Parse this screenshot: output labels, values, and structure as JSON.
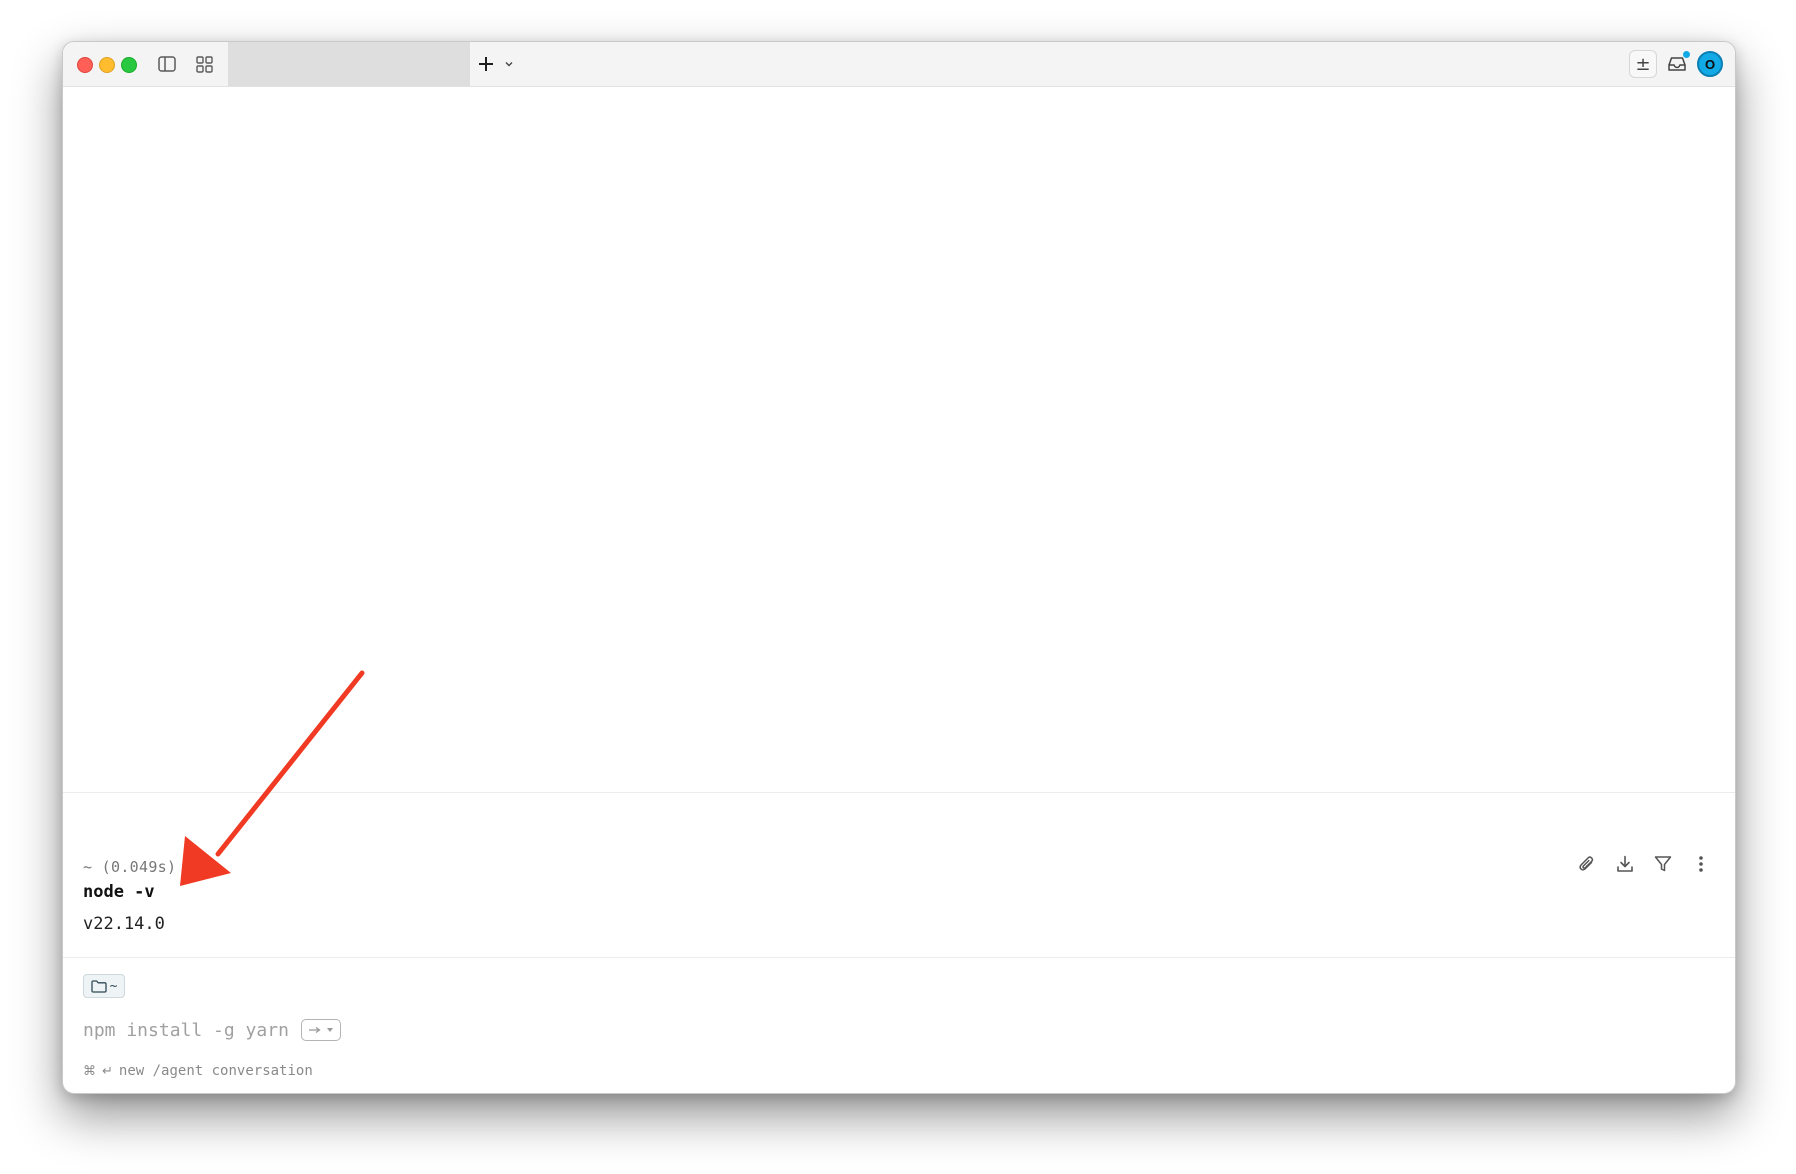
{
  "window": {
    "title_tab_label": "",
    "new_tab_label": "+",
    "new_tab_menu": "chevron-down",
    "avatar_initial": "O",
    "accent": "#11a9e6"
  },
  "block": {
    "meta": "~ (0.049s)",
    "command": "node -v",
    "output": "v22.14.0"
  },
  "input": {
    "dir_label": "~",
    "placeholder": "npm install -g yarn",
    "hint_key_cmd": "⌘",
    "hint_key_enter": "↵",
    "hint_text": "new /agent conversation"
  },
  "annotation": {
    "arrow_color": "#f03a23"
  }
}
